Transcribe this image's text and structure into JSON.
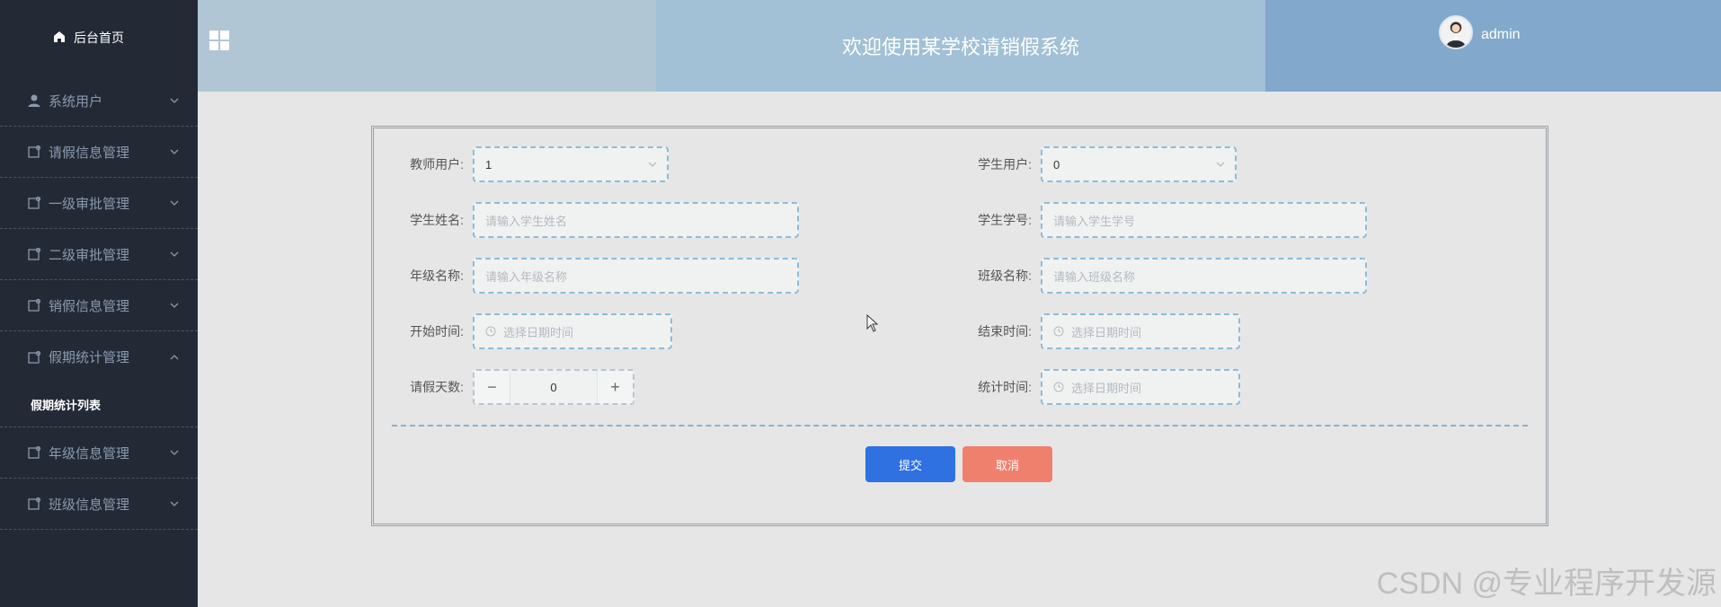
{
  "sidebar": {
    "home_label": "后台首页",
    "items": [
      {
        "label": "系统用户",
        "icon": "user-icon"
      },
      {
        "label": "请假信息管理",
        "icon": "edit-icon"
      },
      {
        "label": "一级审批管理",
        "icon": "edit-icon"
      },
      {
        "label": "二级审批管理",
        "icon": "edit-icon"
      },
      {
        "label": "销假信息管理",
        "icon": "edit-icon"
      },
      {
        "label": "假期统计管理",
        "icon": "edit-icon",
        "expanded": true
      },
      {
        "label": "年级信息管理",
        "icon": "edit-icon"
      },
      {
        "label": "班级信息管理",
        "icon": "edit-icon"
      }
    ],
    "sub_item": "假期统计列表"
  },
  "header": {
    "title": "欢迎使用某学校请销假系统",
    "user": "admin"
  },
  "form": {
    "teacher_label": "教师用户:",
    "teacher_value": "1",
    "student_label": "学生用户:",
    "student_value": "0",
    "student_name_label": "学生姓名:",
    "student_name_placeholder": "请输入学生姓名",
    "student_no_label": "学生学号:",
    "student_no_placeholder": "请输入学生学号",
    "grade_label": "年级名称:",
    "grade_placeholder": "请输入年级名称",
    "class_label": "班级名称:",
    "class_placeholder": "请输入班级名称",
    "start_label": "开始时间:",
    "start_placeholder": "选择日期时间",
    "end_label": "结束时间:",
    "end_placeholder": "选择日期时间",
    "days_label": "请假天数:",
    "days_value": "0",
    "stat_label": "统计时间:",
    "stat_placeholder": "选择日期时间",
    "submit": "提交",
    "cancel": "取消"
  },
  "watermark": "CSDN @专业程序开发源",
  "colors": {
    "sidebar_bg": "#232a36",
    "submit": "#2f71e0",
    "cancel": "#f0806e"
  }
}
